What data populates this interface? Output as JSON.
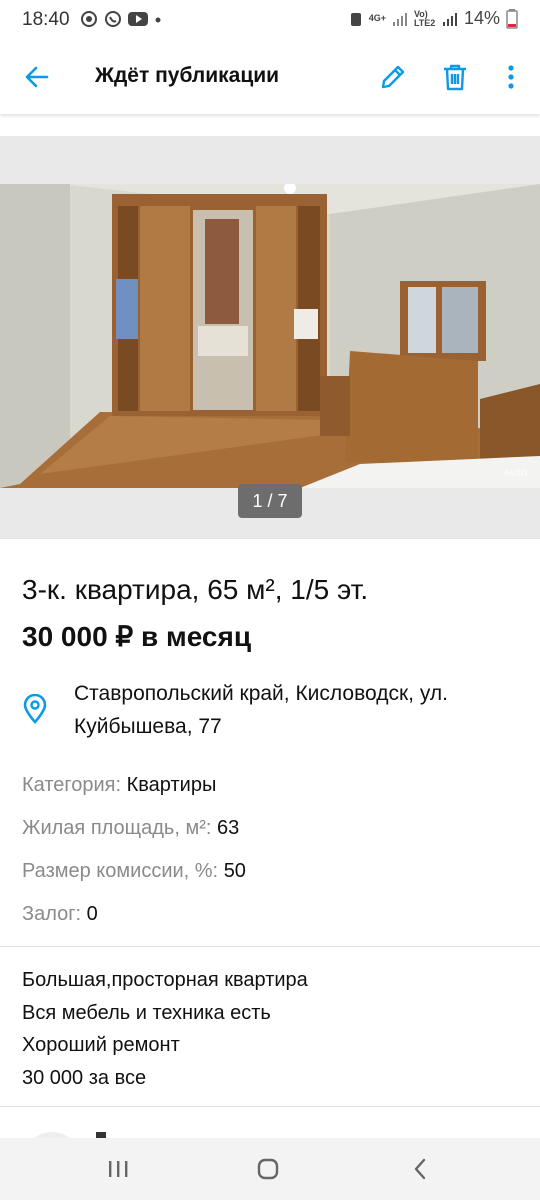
{
  "status_bar": {
    "time": "18:40",
    "network_1": "4G+",
    "network_2": "Vo) LTE2",
    "battery": "14%"
  },
  "app_bar": {
    "title": "Ждёт публикации"
  },
  "gallery": {
    "counter": "1 / 7",
    "watermark": "Avito"
  },
  "listing": {
    "headline": "3-к. квартира, 65 м², 1/5 эт.",
    "price": "30 000 ₽ в месяц",
    "address": "Ставропольский край, Кисловодск, ул. Куйбышева, 77"
  },
  "params": [
    {
      "label": "Категория:",
      "value": "Квартиры"
    },
    {
      "label": "Жилая площадь, м²:",
      "value": "63"
    },
    {
      "label": "Размер комиссии, %:",
      "value": "50"
    },
    {
      "label": "Залог:",
      "value": "0"
    }
  ],
  "description": [
    "Большая,просторная квартира",
    "Вся мебель и техника есть",
    "Хороший ремонт",
    "30 000 за все"
  ],
  "colors": {
    "accent": "#0a9be6",
    "text": "#111111",
    "muted": "#8a8a8a"
  }
}
